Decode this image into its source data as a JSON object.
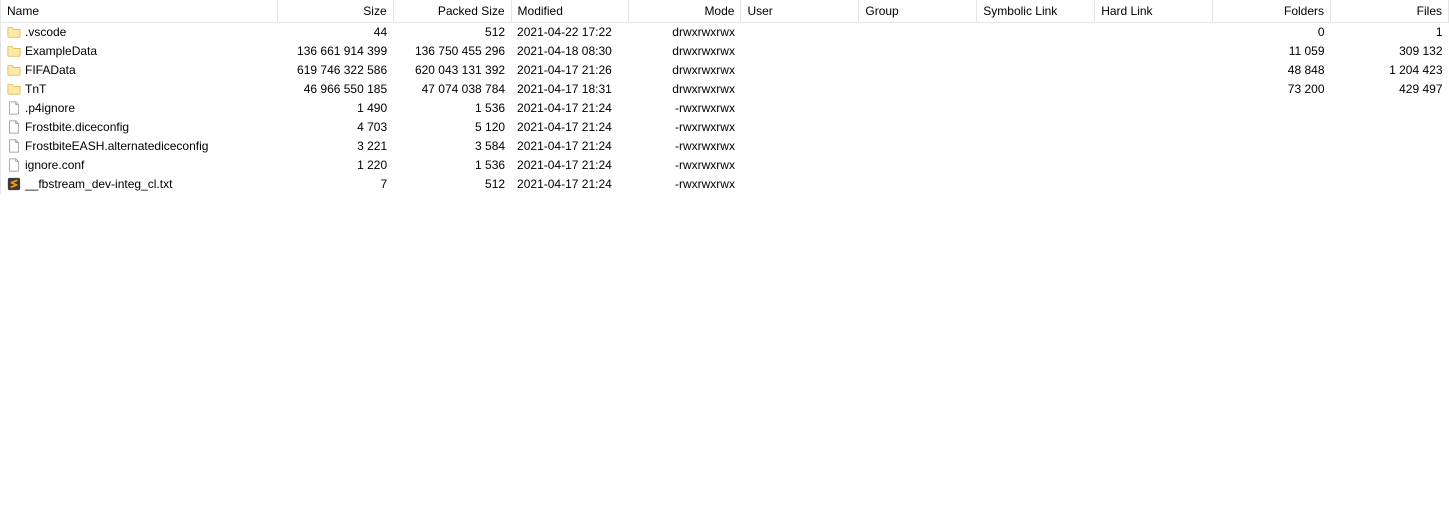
{
  "columns": {
    "name": "Name",
    "size": "Size",
    "packed": "Packed Size",
    "mod": "Modified",
    "mode": "Mode",
    "user": "User",
    "group": "Group",
    "sym": "Symbolic Link",
    "hard": "Hard Link",
    "fold": "Folders",
    "files": "Files"
  },
  "rows": [
    {
      "icon": "folder",
      "name": ".vscode",
      "size": "44",
      "packed": "512",
      "mod": "2021-04-22 17:22",
      "mode": "drwxrwxrwx",
      "fold": "0",
      "files": "1"
    },
    {
      "icon": "folder",
      "name": "ExampleData",
      "size": "136 661 914 399",
      "packed": "136 750 455 296",
      "mod": "2021-04-18 08:30",
      "mode": "drwxrwxrwx",
      "fold": "11 059",
      "files": "309 132"
    },
    {
      "icon": "folder",
      "name": "FIFAData",
      "size": "619 746 322 586",
      "packed": "620 043 131 392",
      "mod": "2021-04-17 21:26",
      "mode": "drwxrwxrwx",
      "fold": "48 848",
      "files": "1 204 423"
    },
    {
      "icon": "folder",
      "name": "TnT",
      "size": "46 966 550 185",
      "packed": "47 074 038 784",
      "mod": "2021-04-17 18:31",
      "mode": "drwxrwxrwx",
      "fold": "73 200",
      "files": "429 497"
    },
    {
      "icon": "file",
      "name": ".p4ignore",
      "size": "1 490",
      "packed": "1 536",
      "mod": "2021-04-17 21:24",
      "mode": "-rwxrwxrwx",
      "fold": "",
      "files": ""
    },
    {
      "icon": "file",
      "name": "Frostbite.diceconfig",
      "size": "4 703",
      "packed": "5 120",
      "mod": "2021-04-17 21:24",
      "mode": "-rwxrwxrwx",
      "fold": "",
      "files": ""
    },
    {
      "icon": "file",
      "name": "FrostbiteEASH.alternatediceconfig",
      "size": "3 221",
      "packed": "3 584",
      "mod": "2021-04-17 21:24",
      "mode": "-rwxrwxrwx",
      "fold": "",
      "files": ""
    },
    {
      "icon": "file",
      "name": "ignore.conf",
      "size": "1 220",
      "packed": "1 536",
      "mod": "2021-04-17 21:24",
      "mode": "-rwxrwxrwx",
      "fold": "",
      "files": ""
    },
    {
      "icon": "sublime",
      "name": "__fbstream_dev-integ_cl.txt",
      "size": "7",
      "packed": "512",
      "mod": "2021-04-17 21:24",
      "mode": "-rwxrwxrwx",
      "fold": "",
      "files": ""
    }
  ]
}
